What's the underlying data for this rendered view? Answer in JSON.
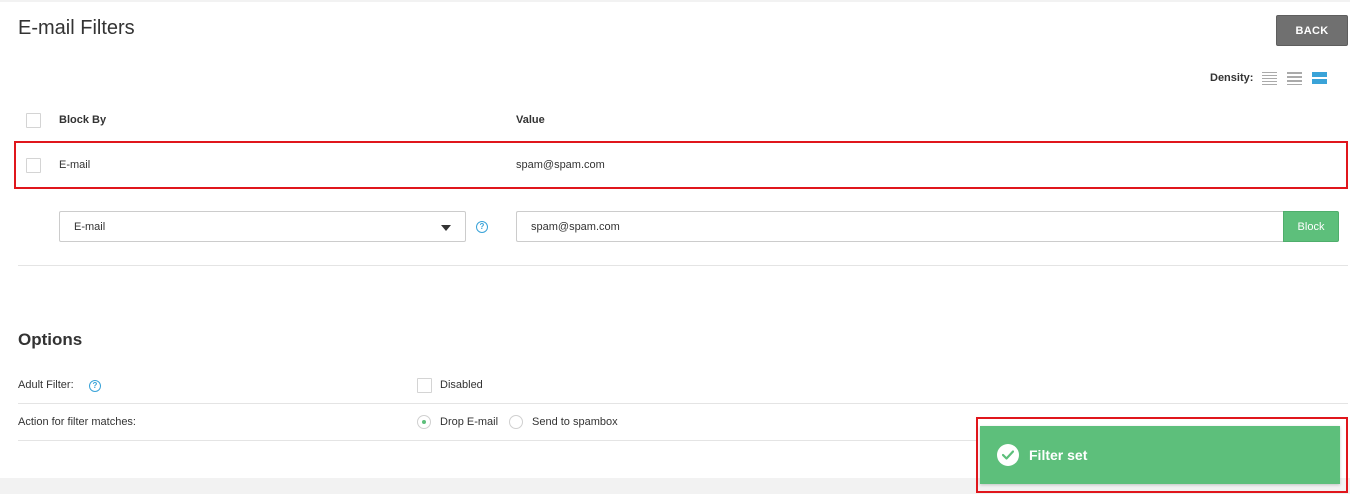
{
  "page": {
    "title": "E-mail Filters",
    "back_label": "BACK"
  },
  "density": {
    "label": "Density:",
    "options": [
      "compact-density-icon",
      "normal-density-icon",
      "comfortable-density-icon"
    ],
    "active": 2
  },
  "table": {
    "headers": {
      "block_by": "Block By",
      "value": "Value"
    },
    "rows": [
      {
        "block_by": "E-mail",
        "value": "spam@spam.com"
      }
    ]
  },
  "add_filter": {
    "type_selected": "E-mail",
    "value": "spam@spam.com",
    "block_label": "Block"
  },
  "options": {
    "title": "Options",
    "adult_filter": {
      "label": "Adult Filter:",
      "checkbox_label": "Disabled"
    },
    "action": {
      "label": "Action for filter matches:",
      "choices": [
        "Drop E-mail",
        "Send to spambox"
      ],
      "selected": "Drop E-mail"
    }
  },
  "toast": {
    "message": "Filter set"
  },
  "colors": {
    "accent": "#3aa3d8",
    "success": "#5dbf7b",
    "highlight": "#e0161c",
    "back_button": "#707070"
  }
}
